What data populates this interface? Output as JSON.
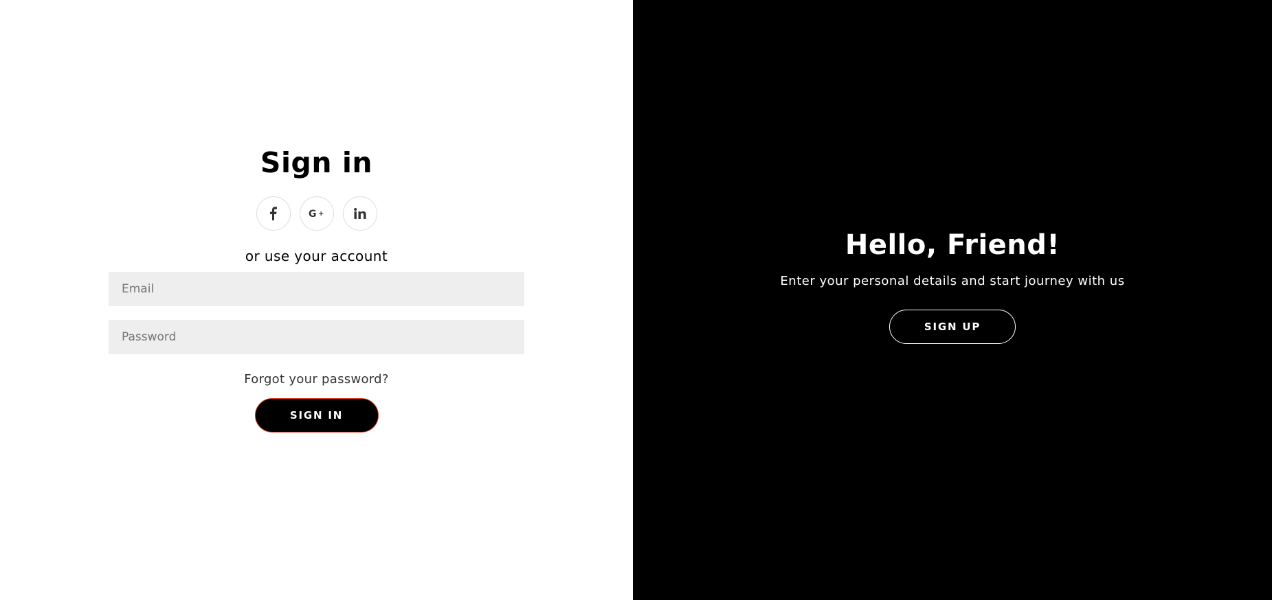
{
  "signin": {
    "title": "Sign in",
    "social": [
      {
        "icon": "facebook-icon",
        "label": "f"
      },
      {
        "icon": "google-plus-icon",
        "label": "G+"
      },
      {
        "icon": "linkedin-icon",
        "label": "in"
      }
    ],
    "alt_text": "or use your account",
    "email_placeholder": "Email",
    "password_placeholder": "Password",
    "forgot_label": "Forgot your password?",
    "button_label": "SIGN IN"
  },
  "overlay": {
    "title": "Hello, Friend!",
    "text": "Enter your personal details and start journey with us",
    "button_label": "SIGN UP"
  },
  "colors": {
    "left_bg": "#ffffff",
    "right_bg": "#000000",
    "input_bg": "#eeeeee",
    "button_border_accent": "#e0331f"
  }
}
